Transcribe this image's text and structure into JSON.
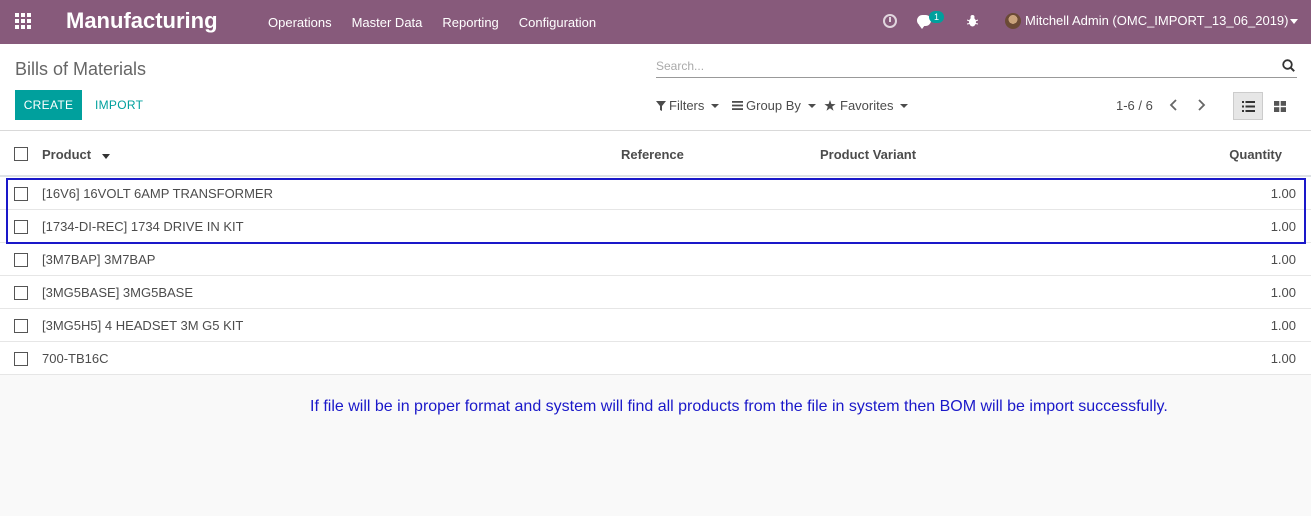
{
  "navbar": {
    "app_title": "Manufacturing",
    "menu": [
      "Operations",
      "Master Data",
      "Reporting",
      "Configuration"
    ],
    "chat_count": "1",
    "user": "Mitchell Admin (OMC_IMPORT_13_06_2019)"
  },
  "control_panel": {
    "breadcrumb": "Bills of Materials",
    "search_placeholder": "Search...",
    "create_label": "CREATE",
    "import_label": "IMPORT",
    "filters_label": "Filters",
    "groupby_label": "Group By",
    "favorites_label": "Favorites",
    "pager": "1-6 / 6"
  },
  "list": {
    "columns": {
      "product": "Product",
      "reference": "Reference",
      "variant": "Product Variant",
      "quantity": "Quantity"
    },
    "rows": [
      {
        "product": "[16V6] 16VOLT 6AMP TRANSFORMER",
        "quantity": "1.00"
      },
      {
        "product": "[1734-DI-REC] 1734 DRIVE IN KIT",
        "quantity": "1.00"
      },
      {
        "product": "[3M7BAP] 3M7BAP",
        "quantity": "1.00"
      },
      {
        "product": "[3MG5BASE] 3MG5BASE",
        "quantity": "1.00"
      },
      {
        "product": "[3MG5H5] 4 HEADSET 3M G5 KIT",
        "quantity": "1.00"
      },
      {
        "product": "700-TB16C",
        "quantity": "1.00"
      }
    ]
  },
  "annotation": {
    "note": "If file will be in proper format and system will find all products from the file in system then BOM will be import successfully.",
    "color": "#1a18c9"
  },
  "colors": {
    "navbar": "#875a7b",
    "primary": "#00a09d"
  }
}
